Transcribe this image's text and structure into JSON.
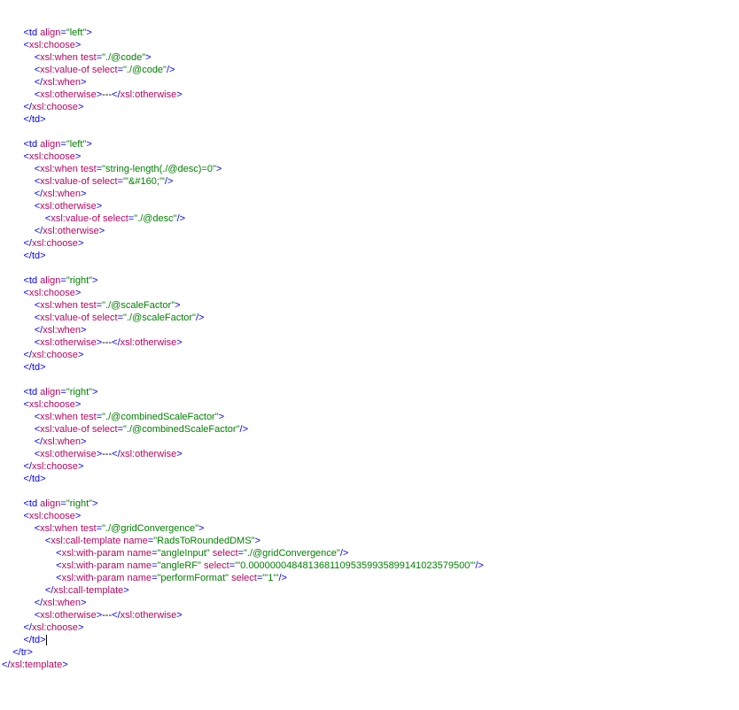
{
  "l": [
    "        <td align=\"left\">",
    "        <xsl:choose>",
    "            <xsl:when test=\"./@code\">",
    "            <xsl:value-of select=\"./@code\"/>",
    "            </xsl:when>",
    "            <xsl:otherwise>---</xsl:otherwise>",
    "        </xsl:choose>",
    "        </td>",
    "",
    "        <td align=\"left\">",
    "        <xsl:choose>",
    "            <xsl:when test=\"string-length(./@desc)=0\">",
    "            <xsl:value-of select=\"'&#160;'\"/>",
    "            </xsl:when>",
    "            <xsl:otherwise>",
    "                <xsl:value-of select=\"./@desc\"/>",
    "            </xsl:otherwise>",
    "        </xsl:choose>",
    "        </td>",
    "",
    "        <td align=\"right\">",
    "        <xsl:choose>",
    "            <xsl:when test=\"./@scaleFactor\">",
    "            <xsl:value-of select=\"./@scaleFactor\"/>",
    "            </xsl:when>",
    "            <xsl:otherwise>---</xsl:otherwise>",
    "        </xsl:choose>",
    "        </td>",
    "",
    "        <td align=\"right\">",
    "        <xsl:choose>",
    "            <xsl:when test=\"./@combinedScaleFactor\">",
    "            <xsl:value-of select=\"./@combinedScaleFactor\"/>",
    "            </xsl:when>",
    "            <xsl:otherwise>---</xsl:otherwise>",
    "        </xsl:choose>",
    "        </td>",
    "",
    "        <td align=\"right\">",
    "        <xsl:choose>",
    "            <xsl:when test=\"./@gridConvergence\">",
    "                <xsl:call-template name=\"RadsToRoundedDMS\">",
    "                    <xsl:with-param name=\"angleInput\" select=\"./@gridConvergence\"/>",
    "                    <xsl:with-param name=\"angleRF\" select=\"'0.00000004848136811095359935899141023579500'\"/>",
    "                    <xsl:with-param name=\"performFormat\" select=\"'1'\"/>",
    "                </xsl:call-template>",
    "            </xsl:when>",
    "            <xsl:otherwise>---</xsl:otherwise>",
    "        </xsl:choose>",
    "        </td>|",
    "    </tr>",
    "</xsl:template>"
  ]
}
